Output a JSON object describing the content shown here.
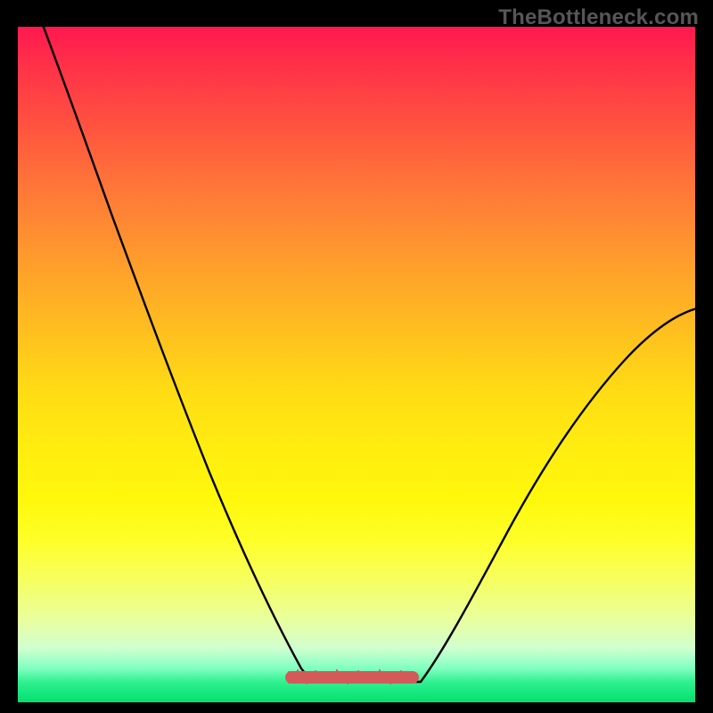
{
  "watermark": "TheBottleneck.com",
  "chart_data": {
    "type": "line",
    "title": "",
    "xlabel": "",
    "ylabel": "",
    "xlim": [
      0,
      100
    ],
    "ylim": [
      0,
      100
    ],
    "grid": false,
    "legend": false,
    "series": [
      {
        "name": "bottleneck-curve",
        "color": "#000000",
        "x": [
          4,
          8,
          12,
          16,
          20,
          24,
          28,
          32,
          36,
          40,
          44,
          48,
          52,
          56,
          60,
          64,
          68,
          72,
          76,
          80,
          84,
          88,
          92,
          96,
          100
        ],
        "y": [
          100,
          92,
          83,
          74,
          65,
          56,
          47,
          38,
          29,
          21,
          13,
          6,
          2,
          0,
          0,
          3,
          9,
          17,
          25,
          33,
          41,
          49,
          56,
          58,
          57
        ]
      }
    ],
    "flat_minimum_band": {
      "x_start": 44,
      "x_end": 63,
      "value": 0,
      "color": "#d45a5a"
    },
    "background_gradient": {
      "top": "#ff1850",
      "mid": "#ffec10",
      "bottom": "#10e67a"
    }
  }
}
